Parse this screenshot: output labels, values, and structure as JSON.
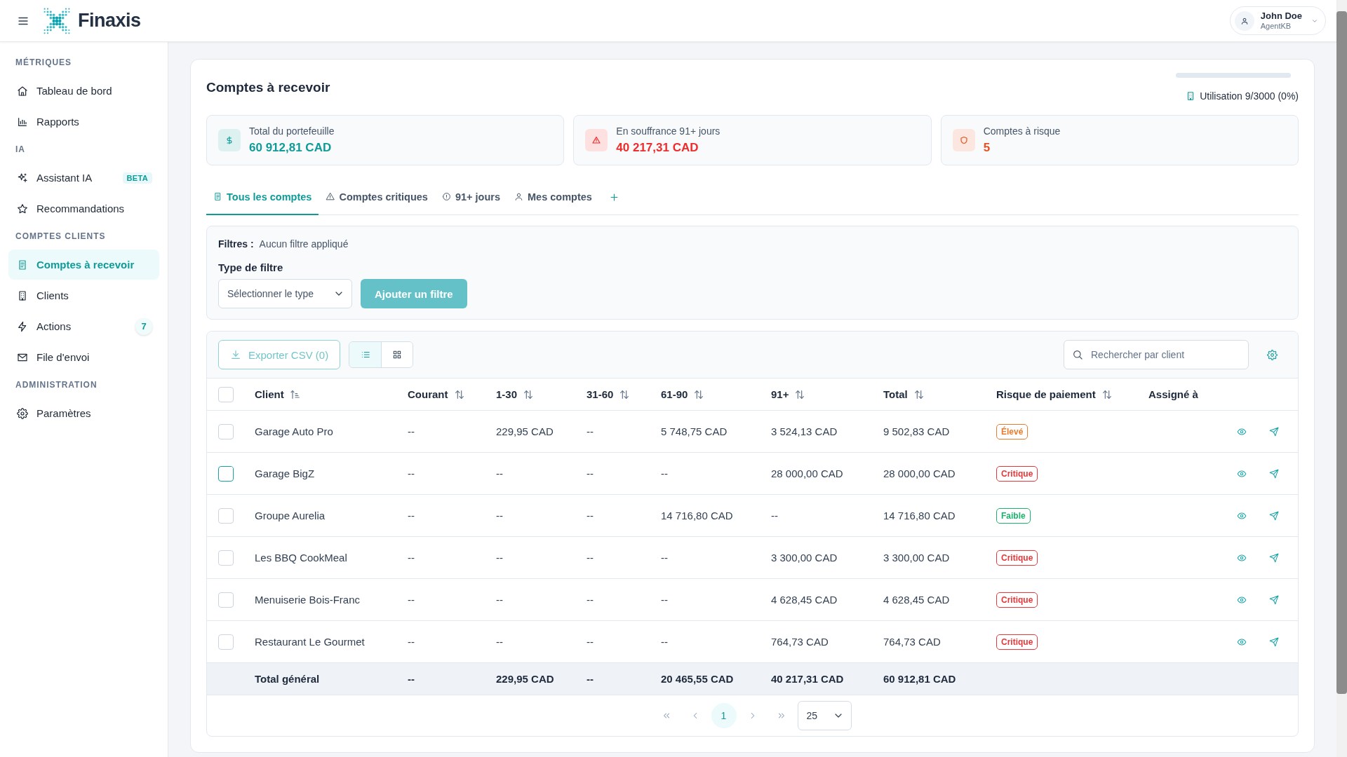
{
  "header": {
    "brand": "Finaxis",
    "user": {
      "name": "John Doe",
      "role": "AgentKB"
    }
  },
  "sidebar": {
    "sections": [
      {
        "title": "MÉTRIQUES",
        "items": [
          {
            "label": "Tableau de bord",
            "selected": false
          },
          {
            "label": "Rapports",
            "selected": false
          }
        ]
      },
      {
        "title": "IA",
        "items": [
          {
            "label": "Assistant IA",
            "selected": false,
            "badge": "BETA"
          },
          {
            "label": "Recommandations",
            "selected": false
          }
        ]
      },
      {
        "title": "COMPTES CLIENTS",
        "items": [
          {
            "label": "Comptes à recevoir",
            "selected": true
          },
          {
            "label": "Clients",
            "selected": false
          },
          {
            "label": "Actions",
            "selected": false,
            "count": "7"
          },
          {
            "label": "File d'envoi",
            "selected": false
          }
        ]
      },
      {
        "title": "ADMINISTRATION",
        "items": [
          {
            "label": "Paramètres",
            "selected": false
          }
        ]
      }
    ]
  },
  "page": {
    "title": "Comptes à recevoir",
    "usage": {
      "label": "Utilisation 9/3000 (0%)",
      "level": 0
    }
  },
  "summary_cards": [
    {
      "label": "Total du portefeuille",
      "value": "60 912,81 CAD",
      "color": "#0f9b98"
    },
    {
      "label": "En souffrance 91+ jours",
      "value": "40 217,31 CAD",
      "color": "#ef2b2b"
    },
    {
      "label": "Comptes à risque",
      "value": "5",
      "color": "#e8501f"
    }
  ],
  "tabs": [
    {
      "label": "Tous les comptes",
      "selected": true
    },
    {
      "label": "Comptes critiques",
      "selected": false
    },
    {
      "label": "91+ jours",
      "selected": false
    },
    {
      "label": "Mes comptes",
      "selected": false
    }
  ],
  "filters": {
    "label": "Filtres :",
    "status": "Aucun filtre appliqué",
    "type_label": "Type de filtre",
    "type_select": {
      "placeholder": "Sélectionner le type"
    },
    "add_button": {
      "label": "Ajouter un filtre",
      "disabled": true
    }
  },
  "toolbar": {
    "export_button": {
      "label": "Exporter CSV (0)",
      "disabled": true
    },
    "views": [
      {
        "kind": "list",
        "selected": true
      },
      {
        "kind": "grid",
        "selected": false
      }
    ],
    "search": {
      "placeholder": "Rechercher par client"
    }
  },
  "table": {
    "select_all": {
      "checked": false
    },
    "columns": [
      {
        "label": "Client",
        "sortable": true,
        "sorted": true
      },
      {
        "label": "Courant",
        "sortable": true,
        "sorted": false
      },
      {
        "label": "1-30",
        "sortable": true,
        "sorted": false
      },
      {
        "label": "31-60",
        "sortable": true,
        "sorted": false
      },
      {
        "label": "61-90",
        "sortable": true,
        "sorted": false
      },
      {
        "label": "91+",
        "sortable": true,
        "sorted": false
      },
      {
        "label": "Total",
        "sortable": true,
        "sorted": false
      },
      {
        "label": "Risque de paiement",
        "sortable": true,
        "sorted": false
      },
      {
        "label": "Assigné à",
        "sortable": false
      }
    ],
    "rows": [
      {
        "checked": false,
        "focused": false,
        "cells": [
          "Garage Auto Pro",
          "--",
          "229,95 CAD",
          "--",
          "5 748,75 CAD",
          "3 524,13 CAD",
          "9 502,83 CAD"
        ],
        "risk": {
          "label": "Élevé",
          "color": "#ea7a2c"
        }
      },
      {
        "checked": false,
        "focused": true,
        "cells": [
          "Garage BigZ",
          "--",
          "--",
          "--",
          "--",
          "28 000,00 CAD",
          "28 000,00 CAD"
        ],
        "risk": {
          "label": "Critique",
          "color": "#e5383b"
        }
      },
      {
        "checked": false,
        "focused": false,
        "cells": [
          "Groupe Aurelia",
          "--",
          "--",
          "--",
          "14 716,80 CAD",
          "--",
          "14 716,80 CAD"
        ],
        "risk": {
          "label": "Faible",
          "color": "#19b36b"
        }
      },
      {
        "checked": false,
        "focused": false,
        "cells": [
          "Les BBQ CookMeal",
          "--",
          "--",
          "--",
          "--",
          "3 300,00 CAD",
          "3 300,00 CAD"
        ],
        "risk": {
          "label": "Critique",
          "color": "#e5383b"
        }
      },
      {
        "checked": false,
        "focused": false,
        "cells": [
          "Menuiserie Bois-Franc",
          "--",
          "--",
          "--",
          "--",
          "4 628,45 CAD",
          "4 628,45 CAD"
        ],
        "risk": {
          "label": "Critique",
          "color": "#e5383b"
        }
      },
      {
        "checked": false,
        "focused": false,
        "cells": [
          "Restaurant Le Gourmet",
          "--",
          "--",
          "--",
          "--",
          "764,73 CAD",
          "764,73 CAD"
        ],
        "risk": {
          "label": "Critique",
          "color": "#e5383b"
        }
      }
    ],
    "total_row": {
      "label": "Total général",
      "cells": [
        "--",
        "229,95 CAD",
        "--",
        "20 465,55 CAD",
        "40 217,31 CAD",
        "60 912,81 CAD"
      ]
    }
  },
  "pagination": {
    "pages": [
      {
        "label": "1",
        "selected": true
      }
    ],
    "page_size": "25"
  }
}
